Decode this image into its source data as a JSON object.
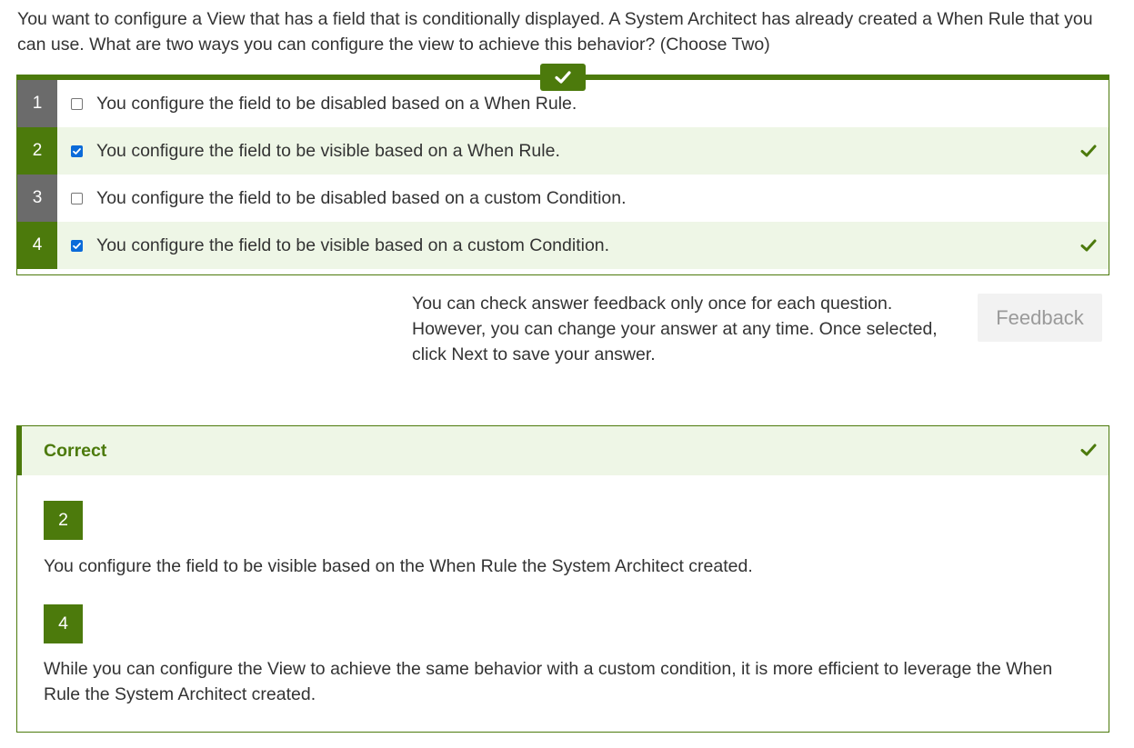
{
  "question": "You want to configure a View that has a field that is conditionally displayed. A System Architect has already created a When Rule that you can use. What are two ways you can configure the view to achieve this behavior? (Choose Two)",
  "options": [
    {
      "number": "1",
      "label": "You configure the field to be disabled based on a When Rule.",
      "checked": false,
      "correct": false
    },
    {
      "number": "2",
      "label": "You configure the field to be visible based on a When Rule.",
      "checked": true,
      "correct": true
    },
    {
      "number": "3",
      "label": "You configure the field to be disabled based on a custom Condition.",
      "checked": false,
      "correct": false
    },
    {
      "number": "4",
      "label": "You configure the field to be visible based on a custom Condition.",
      "checked": true,
      "correct": true
    }
  ],
  "note": "You can check answer feedback only once for each question. However, you can change your answer at any time. Once selected, click Next to save your answer.",
  "feedback_button": "Feedback",
  "result": {
    "title": "Correct",
    "explanations": [
      {
        "number": "2",
        "text": "You configure the field to be visible based on the When Rule the System Architect created."
      },
      {
        "number": "4",
        "text": "While you can configure the View to achieve the same behavior with a custom condition, it is more efficient to leverage the When Rule the System Architect created."
      }
    ]
  },
  "colors": {
    "accent": "#4c7a0c",
    "selected_row": "#eef6e6",
    "checkbox": "#0b6bd9"
  }
}
